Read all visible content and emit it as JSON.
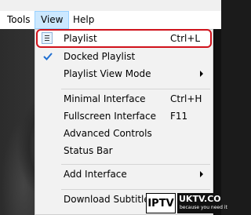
{
  "menubar": {
    "items": [
      {
        "label": "Tools"
      },
      {
        "label": "View",
        "active": true
      },
      {
        "label": "Help"
      }
    ]
  },
  "view_menu": {
    "items": [
      {
        "label": "Playlist",
        "shortcut": "Ctrl+L",
        "icon": "playlist-icon",
        "highlighted": true
      },
      {
        "label": "Docked Playlist",
        "checked": true
      },
      {
        "label": "Playlist View Mode",
        "submenu": true
      },
      {
        "label": "Minimal Interface",
        "shortcut": "Ctrl+H"
      },
      {
        "label": "Fullscreen Interface",
        "shortcut": "F11"
      },
      {
        "label": "Advanced Controls"
      },
      {
        "label": "Status Bar"
      },
      {
        "label": "Add Interface",
        "submenu": true
      },
      {
        "label": "Download Subtitles"
      }
    ]
  },
  "watermark": {
    "left": "IPTV",
    "right_main": "UKTV.CO",
    "right_sub": "because you need it"
  },
  "colors": {
    "highlight_outline": "#d0121b",
    "menu_background": "#f2f2f2",
    "active_menubar_item": "#cce8ff",
    "check_color": "#1f6fd1"
  }
}
